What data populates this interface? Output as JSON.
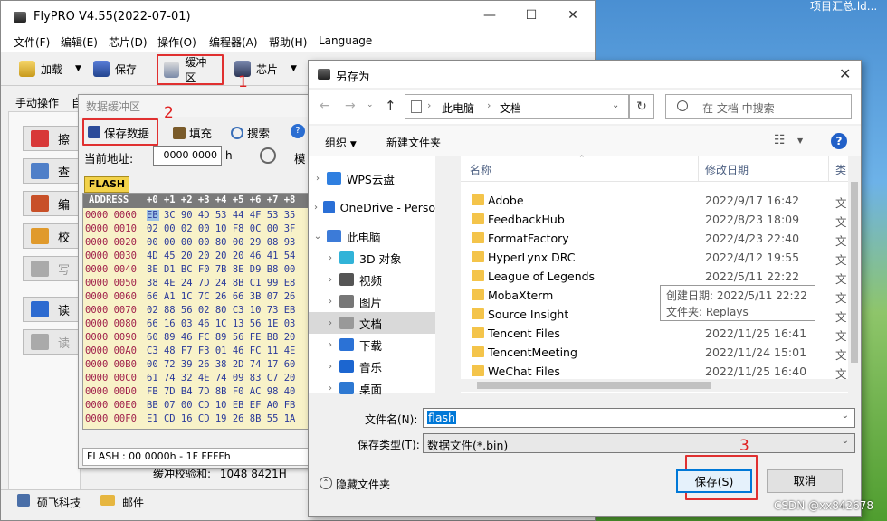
{
  "desktop": {
    "top_text": "项目汇总.ld...",
    "watermark": "CSDN @xx842678"
  },
  "main": {
    "title": "FlyPRO V4.55(2022-07-01)",
    "menu": [
      "文件(F)",
      "编辑(E)",
      "芯片(D)",
      "操作(O)",
      "编程器(A)",
      "帮助(H)",
      "Language"
    ],
    "toolbar": {
      "load": "加载",
      "save": "保存",
      "buffer": "缓冲区",
      "chip": "芯片"
    },
    "tabs": {
      "manual": "手动操作",
      "auto": "自"
    },
    "left_buttons": [
      "擦",
      "查",
      "编",
      "校",
      "写",
      "读",
      "读"
    ],
    "checksum_label": "缓冲校验和:",
    "checksum_value": "1048 8421H",
    "status": {
      "company": "硕飞科技",
      "mail": "邮件"
    },
    "annotation_1": "1"
  },
  "buffer": {
    "title": "数据缓冲区",
    "save_data": "保存数据",
    "fill": "填充",
    "search": "搜索",
    "addr_label": "当前地址:",
    "addr_value": "0000 0000",
    "addr_unit": "h",
    "mode_label": "模",
    "annotation_2": "2",
    "flash_tab": "FLASH",
    "hex_header_addr": "ADDRESS",
    "hex_header_cols": "+0 +1 +2 +3 +4 +5 +6 +7 +8",
    "rows": [
      {
        "addr": "0000 0000",
        "data": "EB 3C 90 4D 53 44 4F 53 35"
      },
      {
        "addr": "0000 0010",
        "data": "02 00 02 00 10 F8 0C 00 3F"
      },
      {
        "addr": "0000 0020",
        "data": "00 00 00 00 80 00 29 08 93"
      },
      {
        "addr": "0000 0030",
        "data": "4D 45 20 20 20 20 46 41 54"
      },
      {
        "addr": "0000 0040",
        "data": "8E D1 BC F0 7B 8E D9 B8 00"
      },
      {
        "addr": "0000 0050",
        "data": "38 4E 24 7D 24 8B C1 99 E8"
      },
      {
        "addr": "0000 0060",
        "data": "66 A1 1C 7C 26 66 3B 07 26"
      },
      {
        "addr": "0000 0070",
        "data": "02 88 56 02 80 C3 10 73 EB"
      },
      {
        "addr": "0000 0080",
        "data": "66 16 03 46 1C 13 56 1E 03"
      },
      {
        "addr": "0000 0090",
        "data": "60 89 46 FC 89 56 FE B8 20"
      },
      {
        "addr": "0000 00A0",
        "data": "C3 48 F7 F3 01 46 FC 11 4E"
      },
      {
        "addr": "0000 00B0",
        "data": "00 72 39 26 38 2D 74 17 60"
      },
      {
        "addr": "0000 00C0",
        "data": "61 74 32 4E 74 09 83 C7 20"
      },
      {
        "addr": "0000 00D0",
        "data": "FB 7D B4 7D 8B F0 AC 98 40"
      },
      {
        "addr": "0000 00E0",
        "data": "BB 07 00 CD 10 EB EF A0 FB"
      },
      {
        "addr": "0000 00F0",
        "data": "E1 CD 16 CD 19 26 8B 55 1A"
      }
    ],
    "status": "FLASH : 00 0000h - 1F FFFFh"
  },
  "dialog": {
    "title": "另存为",
    "path": [
      "此电脑",
      "文档"
    ],
    "search_placeholder": "在 文档 中搜索",
    "organize": "组织",
    "new_folder": "新建文件夹",
    "nav": [
      {
        "label": "WPS云盘",
        "color": "#2f7fe0"
      },
      {
        "label": "OneDrive - Perso",
        "color": "#2a6fd6"
      },
      {
        "label": "此电脑",
        "color": "#3c7bd8"
      },
      {
        "label": "3D 对象",
        "color": "#31b3d8"
      },
      {
        "label": "视频",
        "color": "#555"
      },
      {
        "label": "图片",
        "color": "#777"
      },
      {
        "label": "文档",
        "color": "#999"
      },
      {
        "label": "下载",
        "color": "#2b72d6"
      },
      {
        "label": "音乐",
        "color": "#1c66d0"
      },
      {
        "label": "桌面",
        "color": "#2d78d2"
      }
    ],
    "columns": {
      "name": "名称",
      "date": "修改日期",
      "type": "类"
    },
    "files": [
      {
        "name": "Adobe",
        "date": "2022/9/17 16:42",
        "type": "文"
      },
      {
        "name": "FeedbackHub",
        "date": "2022/8/23 18:09",
        "type": "文"
      },
      {
        "name": "FormatFactory",
        "date": "2022/4/23 22:40",
        "type": "文"
      },
      {
        "name": "HyperLynx DRC",
        "date": "2022/4/12 19:55",
        "type": "文"
      },
      {
        "name": "League of Legends",
        "date": "2022/5/11 22:22",
        "type": "文"
      },
      {
        "name": "MobaXterm",
        "date": "",
        "type": "文"
      },
      {
        "name": "Source Insight",
        "date": "",
        "type": "文"
      },
      {
        "name": "Tencent Files",
        "date": "2022/11/25 16:41",
        "type": "文"
      },
      {
        "name": "TencentMeeting",
        "date": "2022/11/24 15:01",
        "type": "文"
      },
      {
        "name": "WeChat Files",
        "date": "2022/11/25 16:40",
        "type": "文"
      }
    ],
    "tooltip_created": "创建日期: 2022/5/11 22:22",
    "tooltip_folder": "文件夹: Replays",
    "filename_label": "文件名(N):",
    "filename_value": "flash",
    "filetype_label": "保存类型(T):",
    "filetype_value": "数据文件(*.bin)",
    "hide_folders": "隐藏文件夹",
    "save": "保存(S)",
    "cancel": "取消",
    "annotation_3": "3"
  }
}
